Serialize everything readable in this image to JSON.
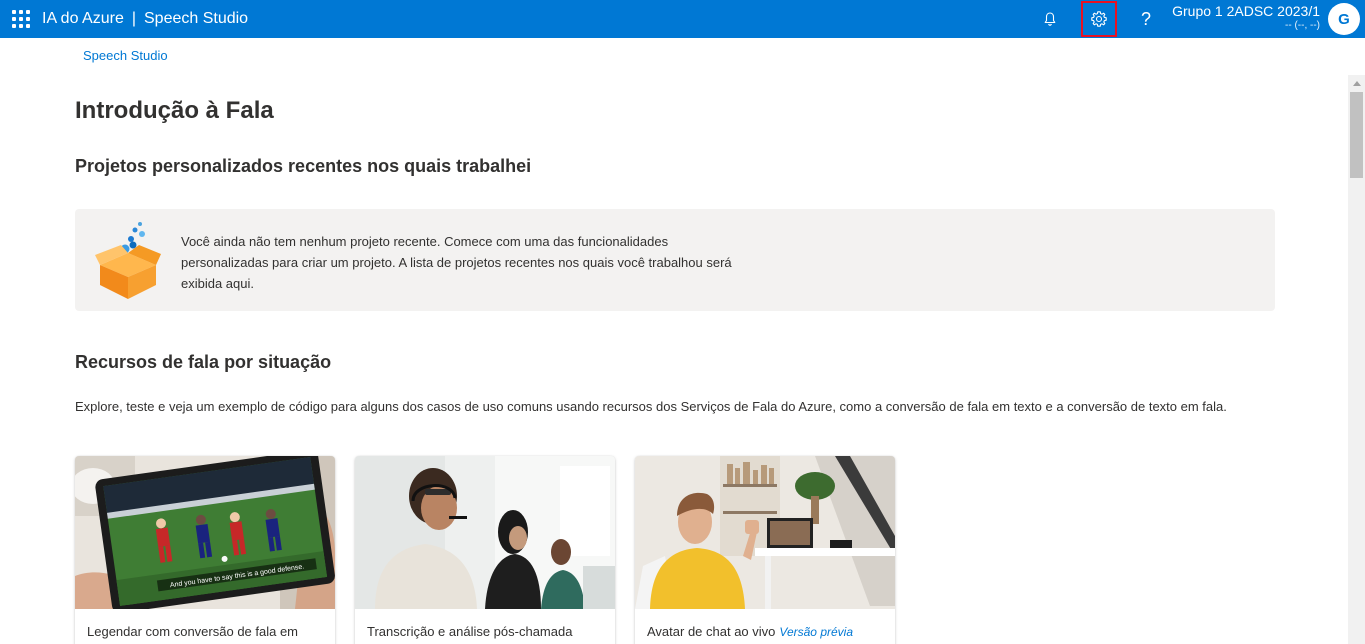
{
  "header": {
    "app_name": "IA do Azure",
    "separator": "|",
    "product": "Speech Studio",
    "user_name": "Grupo 1 2ADSC 2023/1",
    "user_sub": "-- (--, --)",
    "avatar_initial": "G",
    "help_glyph": "?",
    "icons": [
      "waffle-icon",
      "bell-icon",
      "gear-icon",
      "help-icon"
    ],
    "accent_color": "#0078d4",
    "highlight_color": "#e81123"
  },
  "breadcrumb": "Speech Studio",
  "page_title": "Introdução à Fala",
  "recent": {
    "title": "Projetos personalizados recentes nos quais trabalhei",
    "empty_line1": "Você ainda não tem nenhum projeto recente. Comece com uma das funcionalidades",
    "empty_line2": "personalizadas para criar um projeto. A lista de projetos recentes nos quais você trabalhou será",
    "empty_line3": "exibida aqui.",
    "icon": "open-box-icon"
  },
  "scenarios": {
    "title": "Recursos de fala por situação",
    "description": "Explore, teste e veja um exemplo de código para alguns dos casos de uso comuns usando recursos dos Serviços de Fala do Azure, como a conversão de fala em texto e a conversão de texto em fala.",
    "cards": [
      {
        "caption": "Legendar com conversão de fala em",
        "image_subtitle": "And you have to say this is a good defense."
      },
      {
        "caption": "Transcrição e análise pós-chamada"
      },
      {
        "caption": "Avatar de chat ao vivo",
        "badge": "Versão prévia"
      }
    ]
  }
}
